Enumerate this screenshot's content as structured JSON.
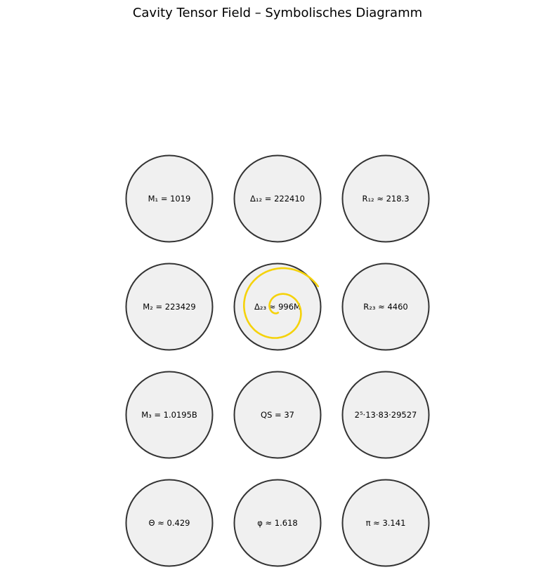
{
  "title": "Cavity Tensor Field – Symbolisches Diagramm",
  "colors": {
    "node_fill": "#f0f0f0",
    "node_stroke": "#333333",
    "spiral": "#f5d20a"
  },
  "nodes": [
    {
      "label": "M₁ = 1019"
    },
    {
      "label": "Δ₁₂ = 222410"
    },
    {
      "label": "R₁₂ ≈ 218.3"
    },
    {
      "label": "M₂ = 223429"
    },
    {
      "label": "Δ₂₃ ≈ 996M"
    },
    {
      "label": "R₂₃ ≈ 4460"
    },
    {
      "label": "M₃ = 1.0195B"
    },
    {
      "label": "QS = 37"
    },
    {
      "label": "2⁵·13·83·29527"
    },
    {
      "label": "Θ ≈ 0.429"
    },
    {
      "label": "φ ≈ 1.618"
    },
    {
      "label": "π ≈ 3.141"
    }
  ]
}
